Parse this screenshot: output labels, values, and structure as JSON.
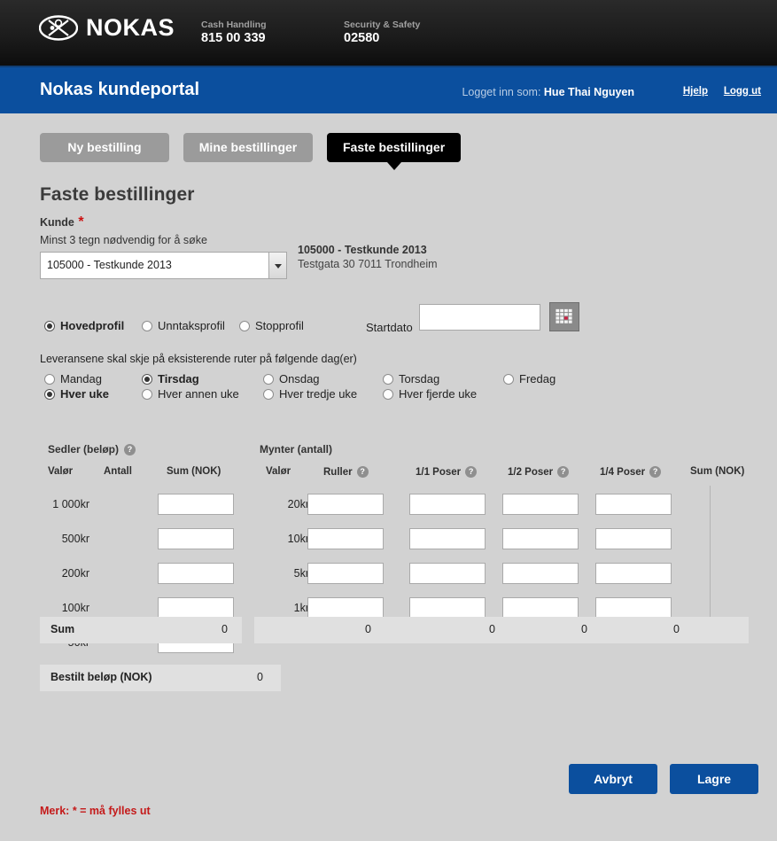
{
  "topbar": {
    "brand": "NOKAS",
    "logo_icon": "nokas-oval-logo-icon",
    "contacts": [
      {
        "label": "Cash Handling",
        "number": "815 00 339"
      },
      {
        "label": "Security & Safety",
        "number": "02580"
      }
    ]
  },
  "bluebar": {
    "portal_title": "Nokas kundeportal",
    "logged_in_prefix": "Logget inn som:",
    "user_name": "Hue Thai Nguyen",
    "help_link": "Hjelp",
    "logout_link": "Logg ut",
    "accent_color": "#0b4f9e"
  },
  "tabs": [
    {
      "label": "Ny bestilling",
      "active": false
    },
    {
      "label": "Mine bestillinger",
      "active": false
    },
    {
      "label": "Faste bestillinger",
      "active": true
    }
  ],
  "page": {
    "title": "Faste bestillinger",
    "customer_label": "Kunde",
    "required_mark": "*",
    "search_hint": "Minst 3 tegn nødvendig for å søke",
    "customer_selected": "105000 - Testkunde 2013",
    "customer_info_name": "105000 - Testkunde 2013",
    "customer_info_address": "Testgata 30 7011 Trondheim"
  },
  "profiles": [
    {
      "label": "Hovedprofil",
      "selected": true
    },
    {
      "label": "Unntaksprofil",
      "selected": false
    },
    {
      "label": "Stopprofil",
      "selected": false
    }
  ],
  "startdato": {
    "label": "Startdato",
    "value": "",
    "calendar_icon": "calendar-icon"
  },
  "delivery": {
    "heading": "Leveransene skal skje på eksisterende ruter på følgende dag(er)",
    "days": [
      {
        "label": "Mandag",
        "selected": false
      },
      {
        "label": "Tirsdag",
        "selected": true
      },
      {
        "label": "Onsdag",
        "selected": false
      },
      {
        "label": "Torsdag",
        "selected": false
      },
      {
        "label": "Fredag",
        "selected": false
      }
    ],
    "frequencies": [
      {
        "label": "Hver uke",
        "selected": true
      },
      {
        "label": "Hver annen uke",
        "selected": false
      },
      {
        "label": "Hver tredje uke",
        "selected": false
      },
      {
        "label": "Hver fjerde uke",
        "selected": false
      }
    ]
  },
  "notes_table": {
    "group_title": "Sedler (beløp)",
    "group_help_icon": "help-icon",
    "columns": [
      "Valør",
      "Antall",
      "Sum (NOK)"
    ],
    "rows": [
      {
        "denom": "1 000kr",
        "value": ""
      },
      {
        "denom": "500kr",
        "value": ""
      },
      {
        "denom": "200kr",
        "value": ""
      },
      {
        "denom": "100kr",
        "value": ""
      },
      {
        "denom": "50kr",
        "value": ""
      }
    ],
    "sum_label": "Sum",
    "sum_value": "0"
  },
  "coins_table": {
    "group_title": "Mynter (antall)",
    "columns": [
      {
        "label": "Valør",
        "help": false
      },
      {
        "label": "Ruller",
        "help": true
      },
      {
        "label": "1/1 Poser",
        "help": true
      },
      {
        "label": "1/2 Poser",
        "help": true
      },
      {
        "label": "1/4 Poser",
        "help": true
      },
      {
        "label": "Sum (NOK)",
        "help": false
      }
    ],
    "rows": [
      {
        "denom": "20kr",
        "ruller": "",
        "p11": "",
        "p12": "",
        "p14": ""
      },
      {
        "denom": "10kr",
        "ruller": "",
        "p11": "",
        "p12": "",
        "p14": ""
      },
      {
        "denom": "5kr",
        "ruller": "",
        "p11": "",
        "p12": "",
        "p14": ""
      },
      {
        "denom": "1kr",
        "ruller": "",
        "p11": "",
        "p12": "",
        "p14": ""
      }
    ],
    "sums": [
      "0",
      "0",
      "0",
      "0"
    ]
  },
  "total": {
    "label": "Bestilt beløp (NOK)",
    "value": "0"
  },
  "actions": {
    "cancel_label": "Avbryt",
    "save_label": "Lagre"
  },
  "footer_note": "Merk: * = må fylles ut"
}
